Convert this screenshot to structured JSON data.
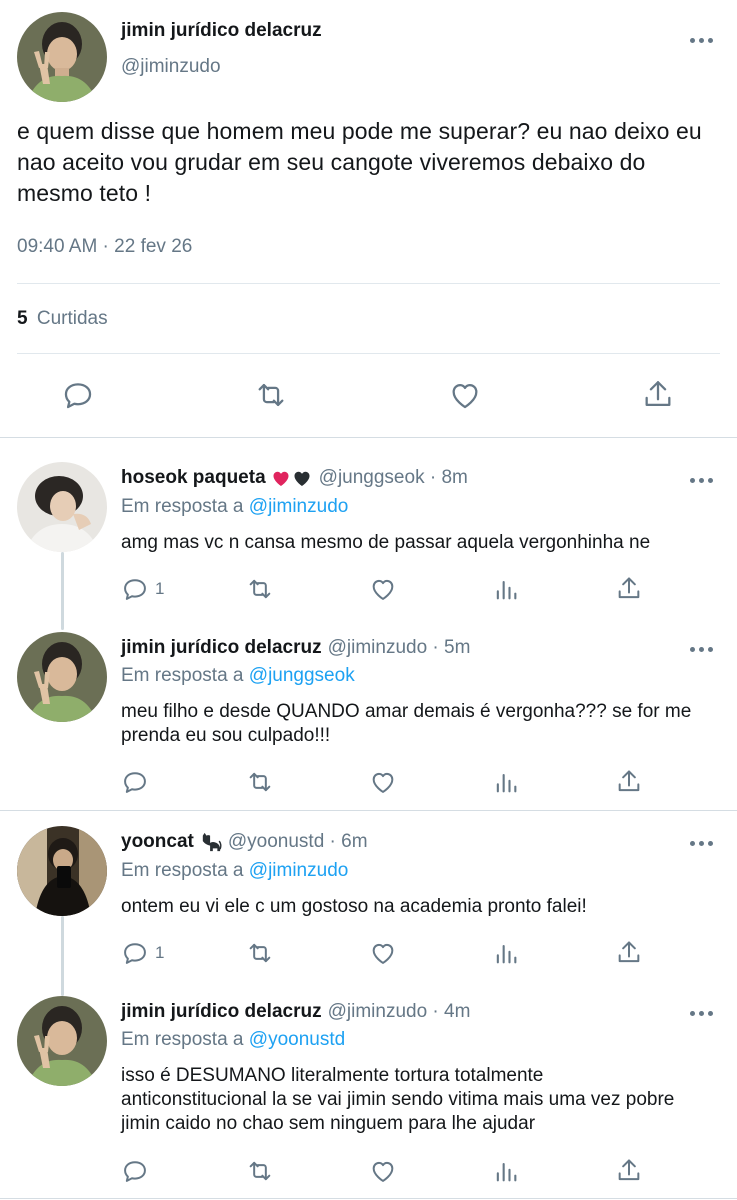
{
  "main": {
    "author_name": "jimin jurídico delacruz",
    "author_handle": "@jiminzudo",
    "text": "e quem disse que homem meu pode me superar? eu nao deixo eu nao aceito vou grudar em seu cangote viveremos debaixo do mesmo teto !",
    "timestamp": "09:40 AM · 22 fev 26",
    "likes_count": "5",
    "likes_label": "Curtidas"
  },
  "replies": [
    {
      "name": "hoseok paqueta",
      "emoji": "❤️🖤",
      "meta": "@junggseok · 8m",
      "reply_prefix": "Em resposta a",
      "reply_to": "@jiminzudo",
      "text": "amg mas vc n cansa mesmo de passar aquela vergonhinha ne",
      "reply_count": "1"
    },
    {
      "name": "jimin jurídico delacruz",
      "meta": "@jiminzudo · 5m",
      "reply_prefix": "Em resposta a",
      "reply_to": "@junggseok",
      "text": "meu filho e desde QUANDO amar demais é vergonha??? se for me prenda eu sou culpado!!!"
    },
    {
      "name": "yooncat",
      "emoji": "🐈‍⬛",
      "meta": "@yoonustd · 6m",
      "reply_prefix": "Em resposta a",
      "reply_to": "@jiminzudo",
      "text": "ontem eu vi ele c um gostoso na academia pronto falei!",
      "reply_count": "1"
    },
    {
      "name": "jimin jurídico delacruz",
      "meta": "@jiminzudo · 4m",
      "reply_prefix": "Em resposta a",
      "reply_to": "@yoonustd",
      "text": "isso é DESUMANO  literalmente tortura totalmente anticonstitucional la se vai jimin sendo vitima mais uma vez pobre jimin caido no chao sem ninguem para lhe ajudar"
    }
  ],
  "icons": {
    "reply": "reply-icon",
    "retweet": "retweet-icon",
    "like": "heart-icon",
    "share": "share-icon",
    "analytics": "analytics-icon",
    "more": "more-icon"
  },
  "colors": {
    "link": "#1da1f2",
    "muted": "#657786",
    "divider": "#e1e8ed",
    "heart_red": "#e0245e"
  }
}
